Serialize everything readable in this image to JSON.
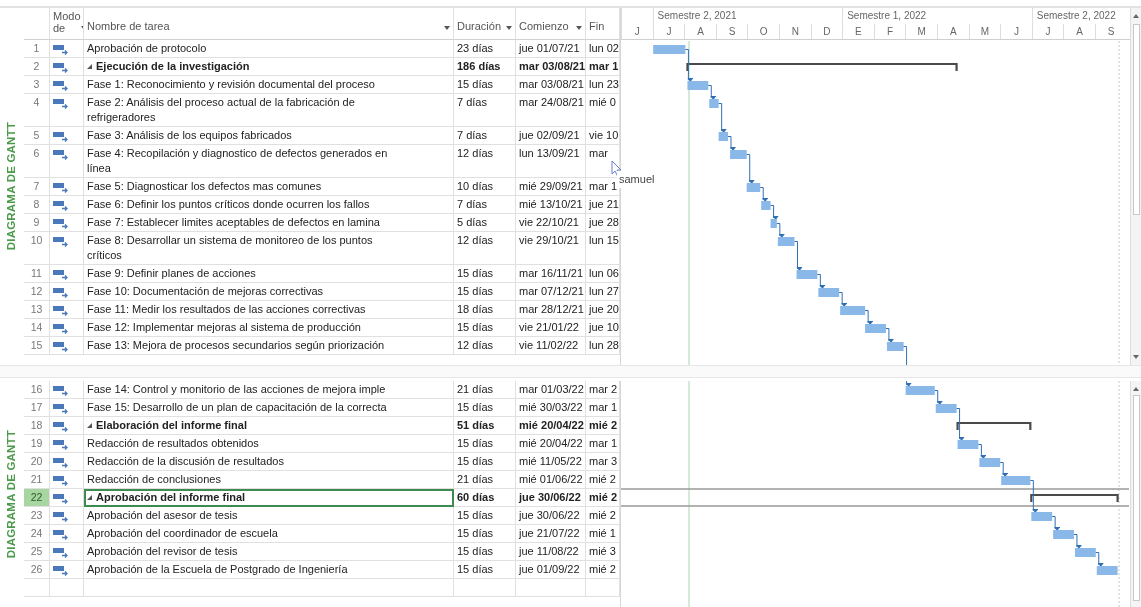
{
  "columns": [
    {
      "label": "Modo de",
      "filter": true
    },
    {
      "label": "Nombre de tarea",
      "filter": true
    },
    {
      "label": "Duración",
      "filter": true
    },
    {
      "label": "Comienzo",
      "filter": true
    },
    {
      "label": "Fin",
      "filter": false
    }
  ],
  "timescale": [
    {
      "months": [
        "J"
      ]
    },
    {
      "label": "Semestre 2, 2021",
      "months": [
        "J",
        "A",
        "S",
        "O",
        "N",
        "D"
      ]
    },
    {
      "label": "Semestre 1, 2022",
      "months": [
        "E",
        "F",
        "M",
        "A",
        "M",
        "J"
      ]
    },
    {
      "label": "Semestre 2, 2022",
      "months": [
        "J",
        "A",
        "S"
      ]
    }
  ],
  "panes": [
    {
      "view_label": "DIAGRAMA DE GANTT",
      "rows": [
        {
          "id": "1",
          "kind": "task",
          "name": "Aprobación de protocolo",
          "duration": "23 días",
          "start": "jue 01/07/21",
          "finish": "lun 02",
          "selected": false
        },
        {
          "id": "2",
          "kind": "summary",
          "expanded": true,
          "name": "Ejecución de la investigación",
          "duration": "186 días",
          "start": "mar 03/08/21",
          "finish": "mar 1",
          "selected": false
        },
        {
          "id": "3",
          "kind": "task",
          "name": "Fase 1: Reconocimiento y revisión documental del proceso",
          "duration": "15 días",
          "start": "mar 03/08/21",
          "finish": "lun 23",
          "selected": false
        },
        {
          "id": "4",
          "kind": "task",
          "name": "Fase 2: Análisis del proceso actual de la fabricación de refrigeradores",
          "duration": "7 días",
          "start": "mar 24/08/21",
          "finish": "mié 0",
          "selected": false
        },
        {
          "id": "5",
          "kind": "task",
          "name": "Fase 3: Análisis de los equipos fabricados",
          "duration": "7 días",
          "start": "jue 02/09/21",
          "finish": "vie 10",
          "selected": false
        },
        {
          "id": "6",
          "kind": "task",
          "name": "Fase 4: Recopilación y diagnostico de defectos generados en línea",
          "duration": "12 días",
          "start": "lun 13/09/21",
          "finish": "mar",
          "selected": false
        },
        {
          "id": "7",
          "kind": "task",
          "name": "Fase 5: Diagnosticar los defectos mas comunes",
          "duration": "10 días",
          "start": "mié 29/09/21",
          "finish": "mar 1",
          "selected": false
        },
        {
          "id": "8",
          "kind": "task",
          "name": "Fase 6: Definir los puntos críticos donde ocurren los fallos",
          "duration": "7 días",
          "start": "mié 13/10/21",
          "finish": "jue 21",
          "selected": false
        },
        {
          "id": "9",
          "kind": "task",
          "name": "Fase 7: Establecer limites aceptables de defectos en lamina",
          "duration": "5 días",
          "start": "vie 22/10/21",
          "finish": "jue 28",
          "selected": false
        },
        {
          "id": "10",
          "kind": "task",
          "name": "Fase 8: Desarrollar un sistema de monitoreo de los puntos críticos",
          "duration": "12 días",
          "start": "vie 29/10/21",
          "finish": "lun 15",
          "selected": false
        },
        {
          "id": "11",
          "kind": "task",
          "name": "Fase 9: Definir planes de acciones",
          "duration": "15 días",
          "start": "mar 16/11/21",
          "finish": "lun 06",
          "selected": false
        },
        {
          "id": "12",
          "kind": "task",
          "name": "Fase 10: Documentación de mejoras correctivas",
          "duration": "15 días",
          "start": "mar 07/12/21",
          "finish": "lun 27",
          "selected": false
        },
        {
          "id": "13",
          "kind": "task",
          "name": "Fase 11: Medir los resultados de las acciones correctivas",
          "duration": "18 días",
          "start": "mar 28/12/21",
          "finish": "jue 20",
          "selected": false
        },
        {
          "id": "14",
          "kind": "task",
          "name": "Fase 12: Implementar mejoras al sistema de producción",
          "duration": "15 días",
          "start": "vie 21/01/22",
          "finish": "jue 10",
          "selected": false
        },
        {
          "id": "15",
          "kind": "task",
          "name": "Fase 13: Mejora de procesos secundarios según priorización",
          "duration": "12 días",
          "start": "vie 11/02/22",
          "finish": "lun 28",
          "selected": false
        }
      ]
    },
    {
      "view_label": "DIAGRAMA DE GANTT",
      "rows": [
        {
          "id": "16",
          "kind": "task",
          "name": "Fase 14: Control y monitorio de las acciones de mejora imple",
          "duration": "21 días",
          "start": "mar 01/03/22",
          "finish": "mar 2",
          "selected": false
        },
        {
          "id": "17",
          "kind": "task",
          "name": "Fase 15: Desarrollo de un plan de capacitación de la correcta",
          "duration": "15 días",
          "start": "mié 30/03/22",
          "finish": "mar 1",
          "selected": false
        },
        {
          "id": "18",
          "kind": "summary",
          "expanded": true,
          "name": "Elaboración del informe final",
          "duration": "51 días",
          "start": "mié 20/04/22",
          "finish": "mié 2",
          "selected": false
        },
        {
          "id": "19",
          "kind": "task",
          "name": "Redacción de resultados obtenidos",
          "duration": "15 días",
          "start": "mié 20/04/22",
          "finish": "mar 1",
          "selected": false
        },
        {
          "id": "20",
          "kind": "task",
          "name": "Redacción de la discusión de resultados",
          "duration": "15 días",
          "start": "mié 11/05/22",
          "finish": "mar 3",
          "selected": false
        },
        {
          "id": "21",
          "kind": "task",
          "name": "Redacción de conclusiones",
          "duration": "21 días",
          "start": "mié 01/06/22",
          "finish": "mié 2",
          "selected": false
        },
        {
          "id": "22",
          "kind": "summary",
          "expanded": true,
          "name": "Aprobación del informe final",
          "duration": "60 días",
          "start": "jue 30/06/22",
          "finish": "mié 2",
          "selected": true
        },
        {
          "id": "23",
          "kind": "task",
          "name": "Aprobación del asesor de tesis",
          "duration": "15 días",
          "start": "jue 30/06/22",
          "finish": "mié 2",
          "selected": false
        },
        {
          "id": "24",
          "kind": "task",
          "name": "Aprobación del coordinador de escuela",
          "duration": "15 días",
          "start": "jue 21/07/22",
          "finish": "mié 1",
          "selected": false
        },
        {
          "id": "25",
          "kind": "task",
          "name": "Aprobación del revisor de tesis",
          "duration": "15 días",
          "start": "jue 11/08/22",
          "finish": "mié 3",
          "selected": false
        },
        {
          "id": "26",
          "kind": "task",
          "name": "Aprobación de la Escuela de Postgrado de Ingeniería",
          "duration": "15 días",
          "start": "jue 01/09/22",
          "finish": "mié 2",
          "selected": false
        }
      ]
    }
  ],
  "cursor": {
    "label": "samuel"
  }
}
